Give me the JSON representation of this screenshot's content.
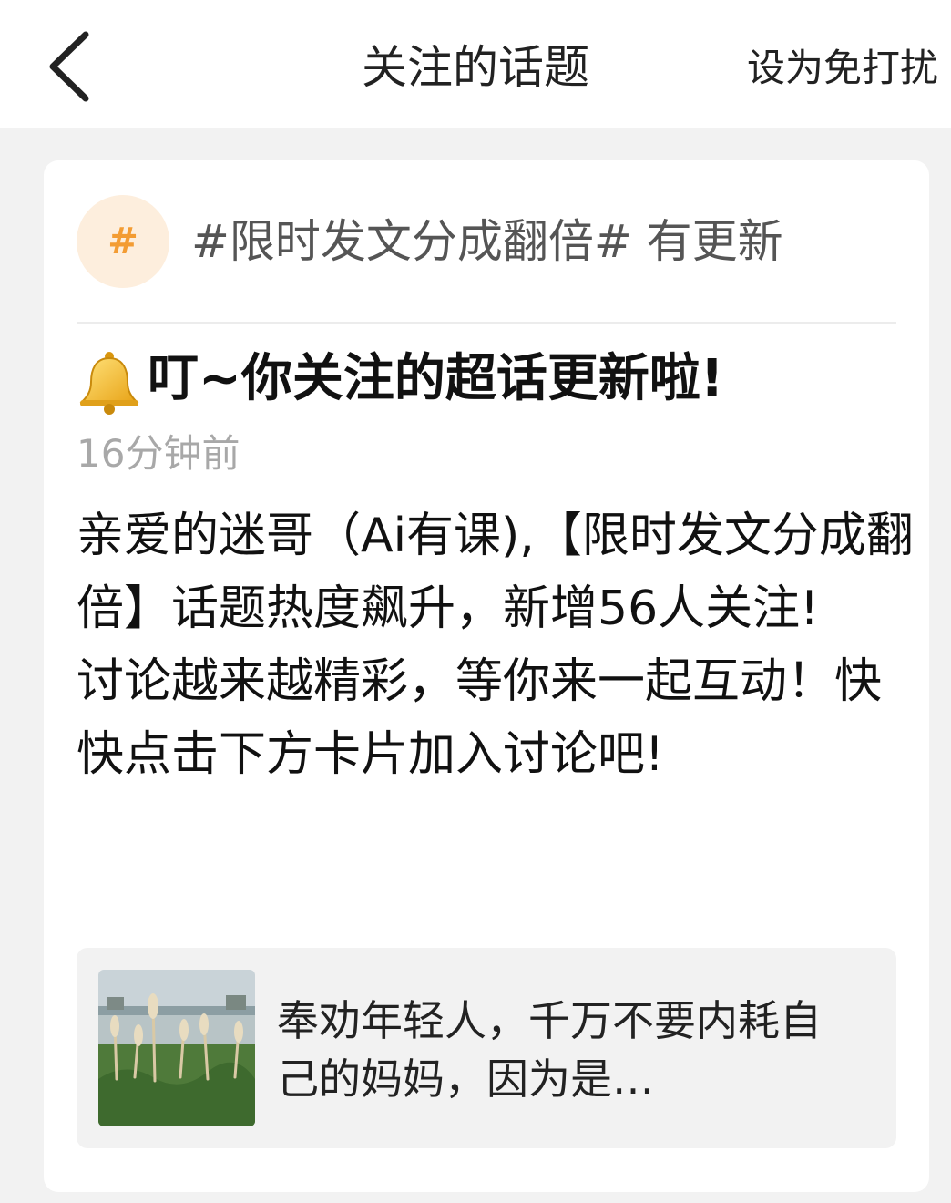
{
  "header": {
    "title": "关注的话题",
    "dnd_label": "设为免打扰",
    "back_icon": "chevron-left-icon"
  },
  "card": {
    "topic_icon": "hash-icon",
    "topic_icon_glyph": "#",
    "topic_text": "#限时发文分成翻倍# 有更新",
    "alert_title": "叮~你关注的超话更新啦!",
    "bell_icon": "bell-icon",
    "time": "16分钟前",
    "message": "亲爱的迷哥（Ai有课),【限时发文分成翻倍】话题热度飙升，新增56人关注!\n讨论越来越精彩，等你来一起互动！快快点击下方卡片加入讨论吧!",
    "preview": {
      "thumbnail": "lake-reeds-photo",
      "text": "奉劝年轻人，千万不要内耗自己的妈妈，因为是…"
    }
  },
  "colors": {
    "page_bg": "#f2f2f2",
    "hash_bg": "#fdeedd",
    "hash_fg": "#f39c33",
    "time_text": "#a8a8a8"
  }
}
